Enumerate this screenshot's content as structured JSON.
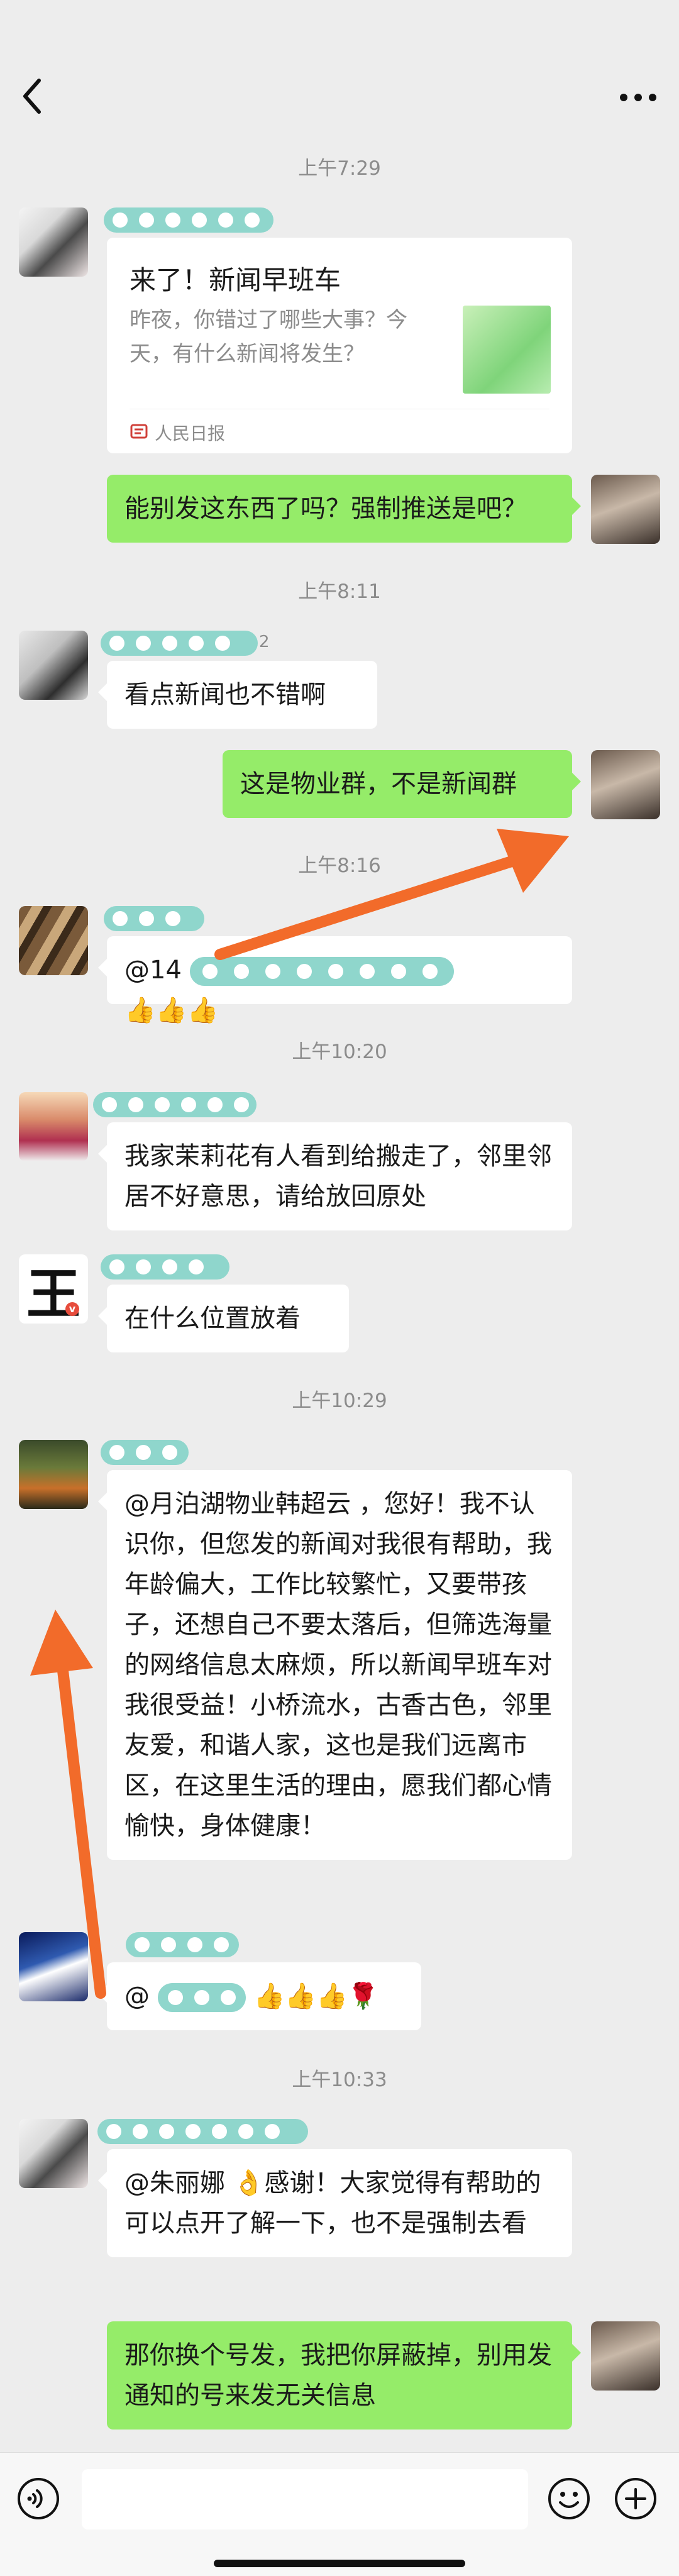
{
  "header": {
    "back_icon": "chevron-left-icon",
    "more_icon": "more-icon"
  },
  "timestamps": [
    "上午7:29",
    "上午8:11",
    "上午8:16",
    "上午10:20",
    "上午10:29",
    "上午10:33"
  ],
  "messages": {
    "m1": {
      "type": "news-card",
      "title": "来了！新闻早班车",
      "description": "昨夜，你错过了哪些大事？今天，有什么新闻将发生？",
      "source": "人民日报"
    },
    "m2": {
      "text": "能别发这东西了吗？强制推送是吧？"
    },
    "m3": {
      "nick_suffix": "2",
      "text": "看点新闻也不错啊"
    },
    "m4": {
      "text": "这是物业群，不是新闻群"
    },
    "m5": {
      "prefix": "@14",
      "emoji": "👍👍👍"
    },
    "m6": {
      "text": "我家茉莉花有人看到给搬走了，邻里邻居不好意思，请给放回原处"
    },
    "m7": {
      "avatar_char": "王",
      "text": "在什么位置放着"
    },
    "m8": {
      "text": "@月泊湖物业韩超云 ，您好！我不认识你，但您发的新闻对我很有帮助，我年龄偏大，工作比较繁忙，又要带孩子，还想自己不要太落后，但筛选海量的网络信息太麻烦，所以新闻早班车对我很受益！小桥流水，古香古色，邻里友爱，和谐人家，这也是我们远离市区，在这里生活的理由，愿我们都心情愉快，身体健康！"
    },
    "m9": {
      "prefix": "@",
      "emoji": "👍👍👍🌹"
    },
    "m10": {
      "text": "@朱丽娜 👌感谢！大家觉得有帮助的可以点开了解一下，也不是强制去看"
    },
    "m11": {
      "text": "那你换个号发，我把你屏蔽掉，别用发通知的号来发无关信息"
    }
  },
  "bottom_bar": {
    "voice_icon": "voice-icon",
    "emoji_icon": "smile-icon",
    "plus_icon": "plus-icon"
  },
  "colors": {
    "background": "#ededed",
    "self_bubble": "#95ec69",
    "other_bubble": "#ffffff",
    "annotation_arrow": "#f26b2a",
    "redaction": "#8fd6cc"
  }
}
